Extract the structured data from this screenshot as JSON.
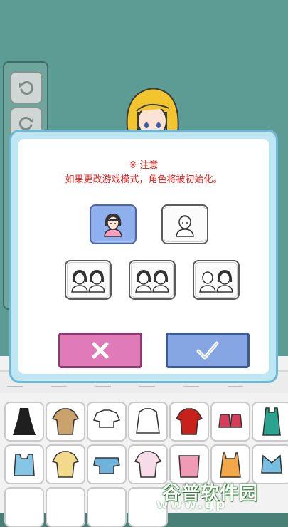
{
  "dialog": {
    "notice_title": "※ 注意",
    "notice_text": "如果更改游戏模式，角色将被初始化。",
    "modes": [
      {
        "id": "single-girl",
        "selected": true
      },
      {
        "id": "single-boy",
        "selected": false
      },
      {
        "id": "pair-girls",
        "selected": false
      },
      {
        "id": "pair-girl-boy",
        "selected": false
      },
      {
        "id": "pair-boys",
        "selected": false
      }
    ],
    "cancel_icon": "x-icon",
    "confirm_icon": "checkmark-icon"
  },
  "toolbar": {
    "undo_icon": "undo-icon",
    "redo_icon": "redo-icon"
  },
  "watermark": {
    "brand": "谷普软件园",
    "url": "www.gp"
  },
  "colors": {
    "background": "#5d9c94",
    "dialog_frame": "#bfe6f3",
    "notice": "#e8211b",
    "cancel": "#e17bb8",
    "confirm": "#86a6e3",
    "selected_mode": "#87a7e8"
  }
}
